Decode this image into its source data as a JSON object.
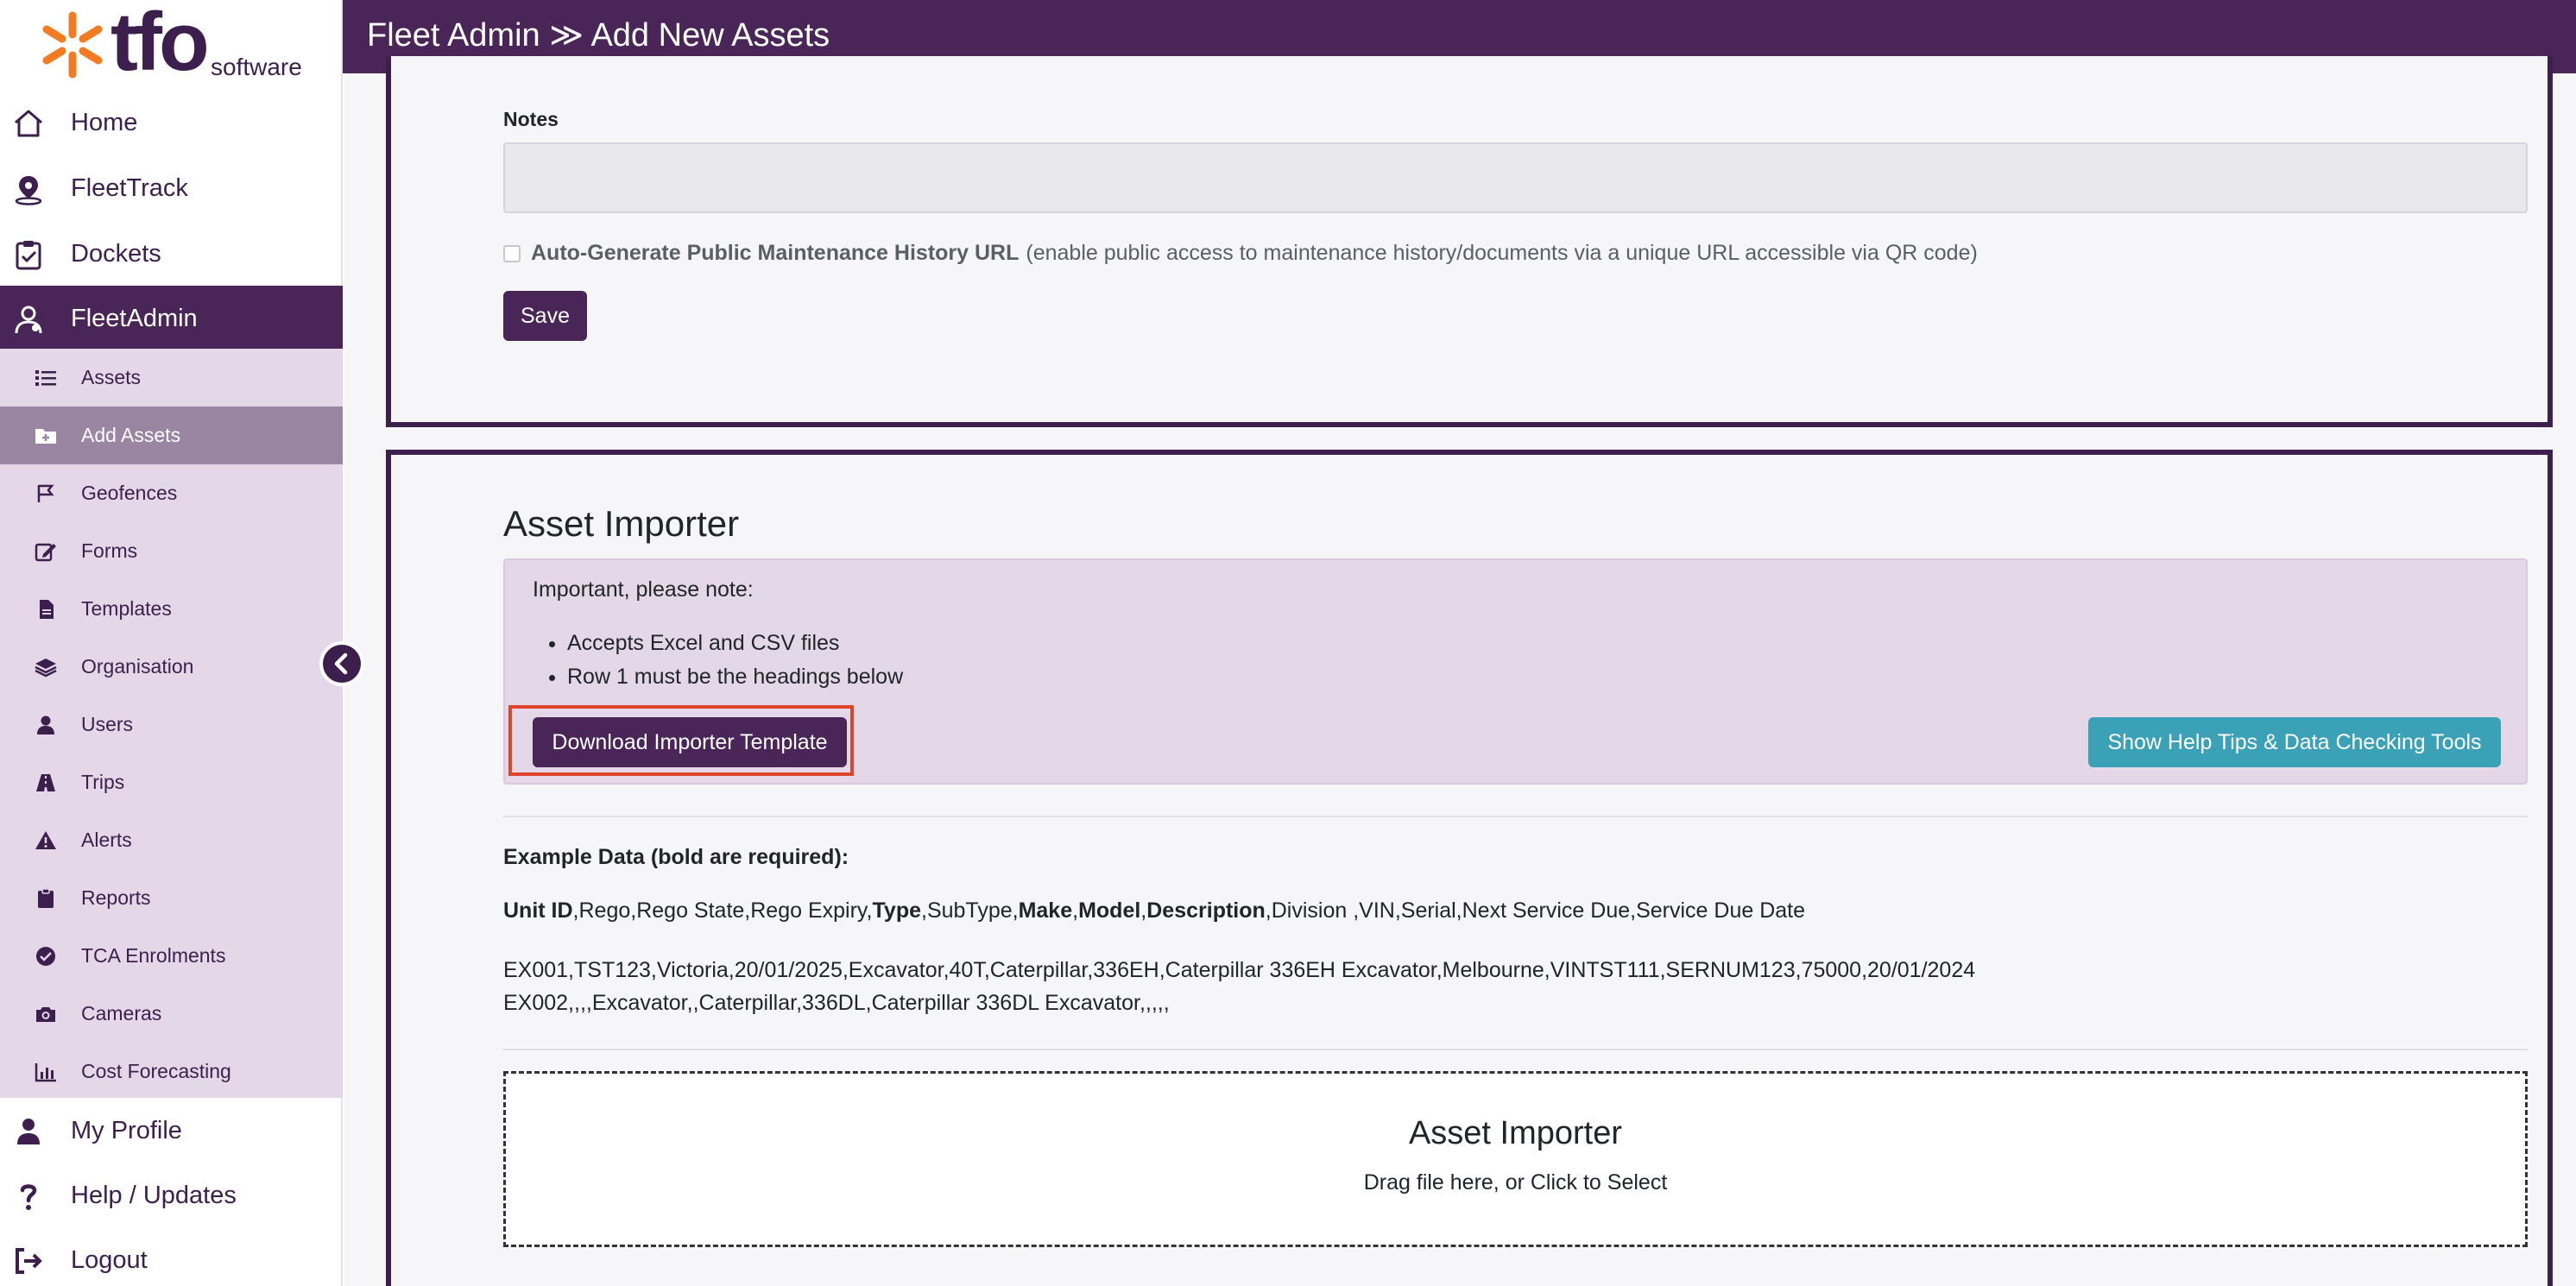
{
  "brand": {
    "name": "tfo",
    "sub": "software",
    "accent": "#f47b20",
    "primary": "#4a2558"
  },
  "header": {
    "title": "Fleet Admin ≫ Add New Assets"
  },
  "sidebar": {
    "top_items": [
      {
        "label": "Home",
        "icon": "home-icon"
      },
      {
        "label": "FleetTrack",
        "icon": "map-pin-icon"
      },
      {
        "label": "Dockets",
        "icon": "clipboard-icon"
      },
      {
        "label": "FleetAdmin",
        "icon": "user-gear-icon",
        "active": true
      }
    ],
    "sub_items": [
      {
        "label": "Assets",
        "icon": "list-icon"
      },
      {
        "label": "Add Assets",
        "icon": "folder-plus-icon",
        "active": true
      },
      {
        "label": "Geofences",
        "icon": "map-flag-icon"
      },
      {
        "label": "Forms",
        "icon": "edit-icon"
      },
      {
        "label": "Templates",
        "icon": "file-icon"
      },
      {
        "label": "Organisation",
        "icon": "layers-icon"
      },
      {
        "label": "Users",
        "icon": "user-icon"
      },
      {
        "label": "Trips",
        "icon": "road-icon"
      },
      {
        "label": "Alerts",
        "icon": "warning-icon"
      },
      {
        "label": "Reports",
        "icon": "clipboard-report-icon"
      },
      {
        "label": "TCA Enrolments",
        "icon": "check-circle-icon"
      },
      {
        "label": "Cameras",
        "icon": "camera-icon"
      },
      {
        "label": "Cost Forecasting",
        "icon": "chart-icon"
      }
    ],
    "bottom_items": [
      {
        "label": "My Profile",
        "icon": "user-icon"
      },
      {
        "label": "Help / Updates",
        "icon": "question-icon"
      },
      {
        "label": "Logout",
        "icon": "logout-icon"
      }
    ]
  },
  "form": {
    "notes_label": "Notes",
    "notes_value": "",
    "auto_gen_bold": "Auto-Generate Public Maintenance History URL",
    "auto_gen_rest": "(enable public access to maintenance history/documents via a unique URL accessible via QR code)",
    "auto_gen_checked": false,
    "save_label": "Save"
  },
  "importer": {
    "title": "Asset Importer",
    "note_heading": "Important, please note:",
    "notes": [
      "Accepts Excel and CSV files",
      "Row 1 must be the headings below"
    ],
    "download_label": "Download Importer Template",
    "help_label": "Show Help Tips & Data Checking Tools",
    "example_label": "Example Data (bold are required):",
    "headings": [
      {
        "text": "Unit ID",
        "bold": true
      },
      {
        "text": ",Rego,Rego State,Rego Expiry,",
        "bold": false
      },
      {
        "text": "Type",
        "bold": true
      },
      {
        "text": ",SubType,",
        "bold": false
      },
      {
        "text": "Make",
        "bold": true
      },
      {
        "text": ",",
        "bold": false
      },
      {
        "text": "Model",
        "bold": true
      },
      {
        "text": ",",
        "bold": false
      },
      {
        "text": "Description",
        "bold": true
      },
      {
        "text": ",Division ,VIN,Serial,Next Service Due,Service Due Date",
        "bold": false
      }
    ],
    "example_rows": [
      "EX001,TST123,Victoria,20/01/2025,Excavator,40T,Caterpillar,336EH,Caterpillar 336EH Excavator,Melbourne,VINTST111,SERNUM123,75000,20/01/2024",
      "EX002,,,,Excavator,,Caterpillar,336DL,Caterpillar 336DL Excavator,,,,,"
    ],
    "dropzone_title": "Asset Importer",
    "dropzone_sub": "Drag file here, or Click to Select"
  }
}
